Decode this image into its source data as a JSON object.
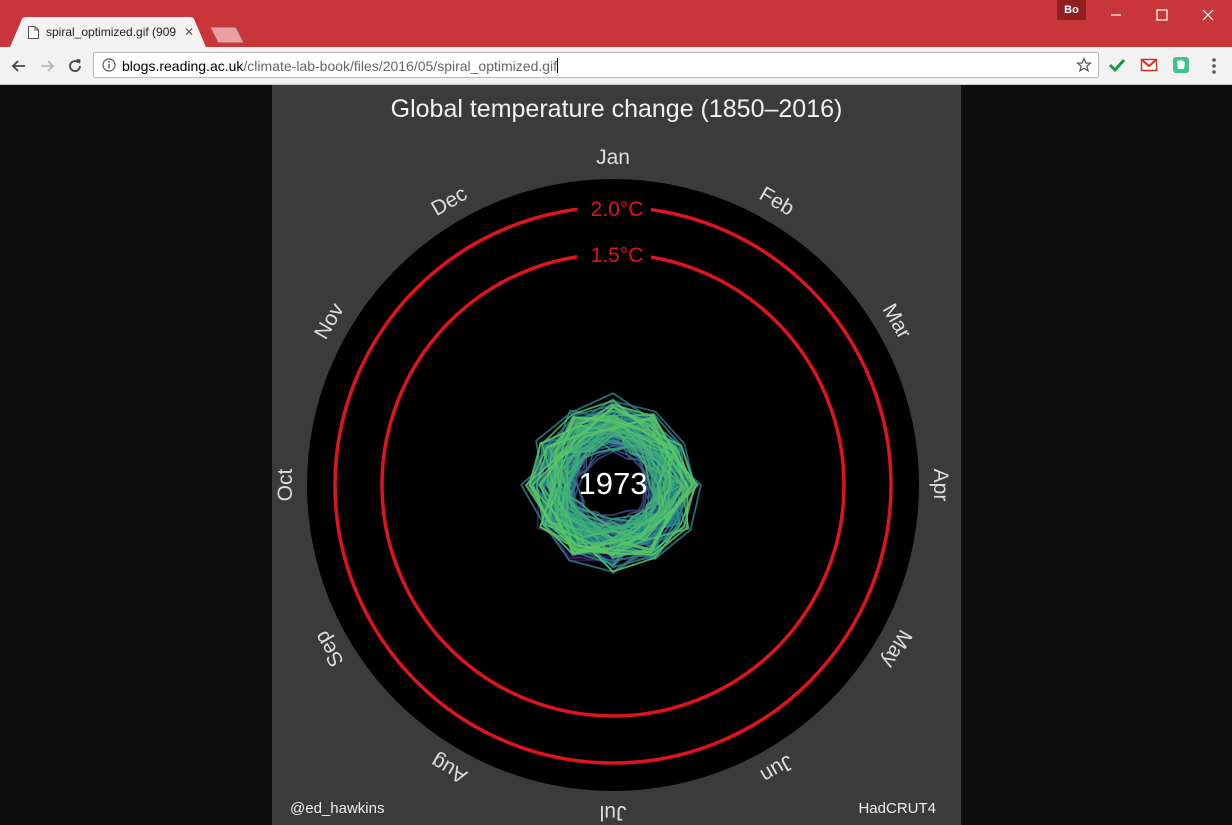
{
  "browser": {
    "tab_title": "spiral_optimized.gif (909",
    "profile_label": "Bo",
    "url_host": "blogs.reading.ac.uk",
    "url_path": "/climate-lab-book/files/2016/05/spiral_optimized.gif",
    "icons": {
      "back": "arrow-left-icon",
      "forward": "arrow-right-icon",
      "reload": "reload-icon",
      "info": "info-icon",
      "bookmark": "star-icon",
      "menu": "kebab-menu-icon",
      "extensions": [
        "checkmark-icon",
        "gmail-icon",
        "evernote-icon"
      ]
    },
    "accent_color": "#c9363a"
  },
  "figure": {
    "title": "Global temperature change (1850–2016)",
    "year": "1973",
    "rings": [
      {
        "label": "2.0°C",
        "value": 2.0
      },
      {
        "label": "1.5°C",
        "value": 1.5
      }
    ],
    "months": [
      "Jan",
      "Feb",
      "Mar",
      "Apr",
      "May",
      "Jun",
      "Jul",
      "Aug",
      "Sep",
      "Oct",
      "Nov",
      "Dec"
    ],
    "credit_left": "@ed_hawkins",
    "credit_right": "HadCRUT4",
    "ring_color": "#e0151b"
  },
  "chart_data": {
    "type": "line",
    "polar": true,
    "title": "Global temperature change (1850–2016)",
    "categories": [
      "Jan",
      "Feb",
      "Mar",
      "Apr",
      "May",
      "Jun",
      "Jul",
      "Aug",
      "Sep",
      "Oct",
      "Nov",
      "Dec"
    ],
    "current_year": 1973,
    "reference_rings_celsius": [
      1.5,
      2.0
    ],
    "colormap": [
      "#440154",
      "#3b528b",
      "#21918c",
      "#5ec962"
    ],
    "series_summary": "Monthly anomalies 1850–1973, roughly between -0.6 and +0.5 °C, drawn as one closed loop per year coloured from purple (early) to green (late)"
  }
}
